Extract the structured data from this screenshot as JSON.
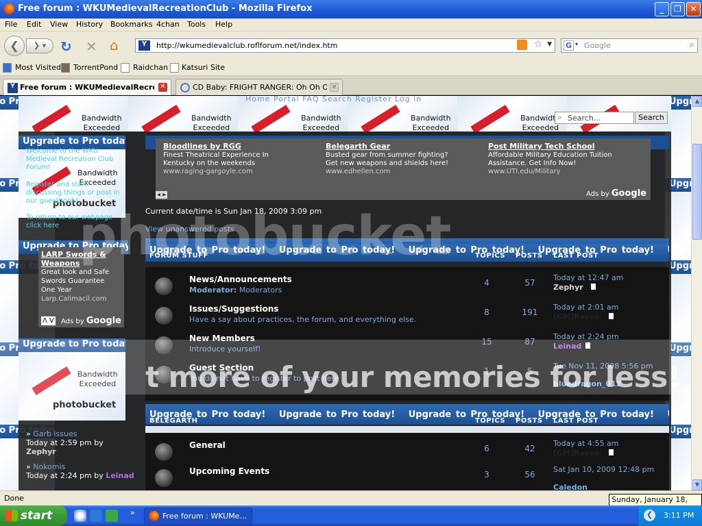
{
  "window": {
    "title": "Free forum : WKUMedievalRecreationClub - Mozilla Firefox"
  },
  "menu": [
    "File",
    "Edit",
    "View",
    "History",
    "Bookmarks",
    "4chan",
    "Tools",
    "Help"
  ],
  "navbar": {
    "url": "http://wkumedievalclub.roflforum.net/index.htm",
    "search_placeholder": "Google"
  },
  "bookmarks": [
    "Most Visited",
    "TorrentPond",
    "Raidchan",
    "Katsuri Site"
  ],
  "tabs": [
    {
      "label": "Free forum : WKUMedievalRecre...",
      "active": true
    },
    {
      "label": "CD Baby: FRIGHT RANGER: Oh Oh Oh ...",
      "active": false
    }
  ],
  "page": {
    "topnav": "Home  Portal  FAQ  Search  Register  Log in",
    "site_search_placeholder": "Search...",
    "site_search_button": "Search",
    "tile_upgrade": "Upgrade to Pro today!",
    "tile_bandwidth_line1": "Bandwidth",
    "tile_bandwidth_line2": "Exceeded",
    "tile_photobucket": "photobucket",
    "welcome_lines": [
      "Welcome to the WKU",
      "Medieval Recreation Club",
      "Forum!"
    ],
    "register_lines": [
      "Register and start",
      "discussing things or post in",
      "our guestbook!"
    ],
    "return_lines": [
      "To return to our webpage",
      "click here"
    ],
    "ads_top": [
      {
        "title": "Bloodlines by RGG",
        "lines": [
          "Finest Theatrical Experience In",
          "Kentucky on the weekends"
        ],
        "url": "www.raging-gargoyle.com"
      },
      {
        "title": "Belegarth Gear",
        "lines": [
          "Busted gear from summer fighting?",
          "Get new weapons and shields here!"
        ],
        "url": "www.edhellen.com"
      },
      {
        "title": "Post Military Tech School",
        "lines": [
          "Affordable Military Education Tuition",
          "Assistance. Get Info Now!"
        ],
        "url": "www.UTI.edu/Military"
      }
    ],
    "ads_by": "Ads by",
    "ads_google": "Google",
    "ad_left": {
      "title": "LARP Swords & Weapons",
      "lines": [
        "Great look and Safe",
        "Swords Guarantee",
        "One Year"
      ],
      "url": "Larp.Calimacil.com"
    },
    "datetime": "Current date/time is Sun Jan 18, 2009 3:09 pm",
    "unanswered": "View unanswered posts",
    "cat1": {
      "name": "FORUM STUFF",
      "topics_h": "TOPICS",
      "posts_h": "POSTS",
      "last_h": "LAST POST"
    },
    "forums1": [
      {
        "name": "News/Announcements",
        "desc_label": "Moderator:",
        "desc": "Moderators",
        "topics": "4",
        "posts": "57",
        "last_time": "Today at 12:47 am",
        "last_user": "Zephyr",
        "user_color": "#d8d8d8"
      },
      {
        "name": "Issues/Suggestions",
        "desc_label": "",
        "desc": "Have a say about practices, the forum, and everything else.",
        "topics": "8",
        "posts": "191",
        "last_time": "Today at 2:01 am",
        "last_user": "[GM]Rayoe",
        "user_color": "#222222"
      },
      {
        "name": "New Members",
        "desc_label": "",
        "desc": "Introduce yourself!",
        "topics": "15",
        "posts": "87",
        "last_time": "Today at 2:24 pm",
        "last_user": "Leinad",
        "user_color": "#b070e8"
      },
      {
        "name": "Guest Section",
        "desc_label": "",
        "desc": "You do not have to register to post here",
        "topics": "1",
        "posts": "5",
        "last_time": "Tue Nov 11, 2008 5:56 pm",
        "last_user": "bluedragon_012",
        "user_color": "#6fb0f0"
      }
    ],
    "cat2": {
      "name": "BELEGARTH",
      "topics_h": "TOPICS",
      "posts_h": "POSTS",
      "last_h": "LAST POST"
    },
    "forums2": [
      {
        "name": "General",
        "topics": "6",
        "posts": "42",
        "last_time": "Today at 4:55 am",
        "last_user": "[GM]Rayoe",
        "user_color": "#222222"
      },
      {
        "name": "Upcoming Events",
        "topics": "3",
        "posts": "56",
        "last_time": "Sat Jan 10, 2009 12:48 pm",
        "last_user": "Caledon",
        "user_color": "#6fb0f0"
      }
    ],
    "recent": [
      {
        "title": "Garb issues",
        "time": "Today at 2:59 pm by",
        "user": "Zephyr",
        "user_color": "#d8d8d8"
      },
      {
        "title": "Nokomis",
        "time": "Today at 2:24 pm by",
        "user": "Leinad",
        "user_color": "#b070e8"
      }
    ],
    "watermark_top": "photobucket",
    "watermark_bottom": "t more of your memories for less!"
  },
  "status": {
    "text": "Done",
    "tooltip": "Sunday, January 18, 2009"
  },
  "taskbar": {
    "start": "start",
    "item": "Free forum : WKUMe...",
    "clock": "3:11 PM"
  }
}
